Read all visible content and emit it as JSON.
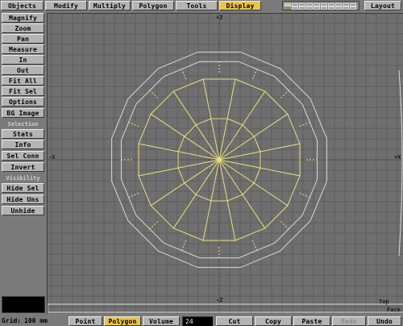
{
  "toolbar": {
    "tabs": [
      {
        "label": "Objects",
        "active": false
      },
      {
        "label": "Modify",
        "active": false
      },
      {
        "label": "Multiply",
        "active": false
      },
      {
        "label": "Polygon",
        "active": false
      },
      {
        "label": "Tools",
        "active": false
      },
      {
        "label": "Display",
        "active": true
      }
    ],
    "layout_label": "Layout"
  },
  "sidebar": {
    "view_buttons": [
      "Magnify",
      "Zoom",
      "Pan",
      "Measure",
      "In",
      "Out",
      "Fit All",
      "Fit Sel",
      "Options",
      "BG Image"
    ],
    "selection_header": "Selection",
    "selection_buttons": [
      "Stats",
      "Info",
      "Sel Conn",
      "Invert"
    ],
    "visibility_header": "Visibility",
    "visibility_buttons": [
      "Hide Sel",
      "Hide Uns",
      "Unhide"
    ]
  },
  "viewport": {
    "axis_top": "+Z",
    "axis_bottom": "-Z",
    "axis_left": "-X",
    "axis_right": "+X",
    "view_label": "Top",
    "face_label": "Face",
    "colors": {
      "background": "#6f6f6f",
      "grid": "#5e5e5e",
      "selected": "#e8e27a",
      "unselected": "#d8d8d8"
    }
  },
  "statusbar": {
    "grid_label": "Grid:",
    "grid_value": "100 mm",
    "modes": [
      {
        "label": "Point",
        "active": false
      },
      {
        "label": "Polygon",
        "active": true
      },
      {
        "label": "Volume",
        "active": false
      }
    ],
    "count": "24",
    "edit_buttons": [
      {
        "label": "Cut",
        "enabled": true
      },
      {
        "label": "Copy",
        "enabled": true
      },
      {
        "label": "Paste",
        "enabled": true
      },
      {
        "label": "Redo",
        "enabled": false
      },
      {
        "label": "Undo",
        "enabled": true
      }
    ]
  }
}
